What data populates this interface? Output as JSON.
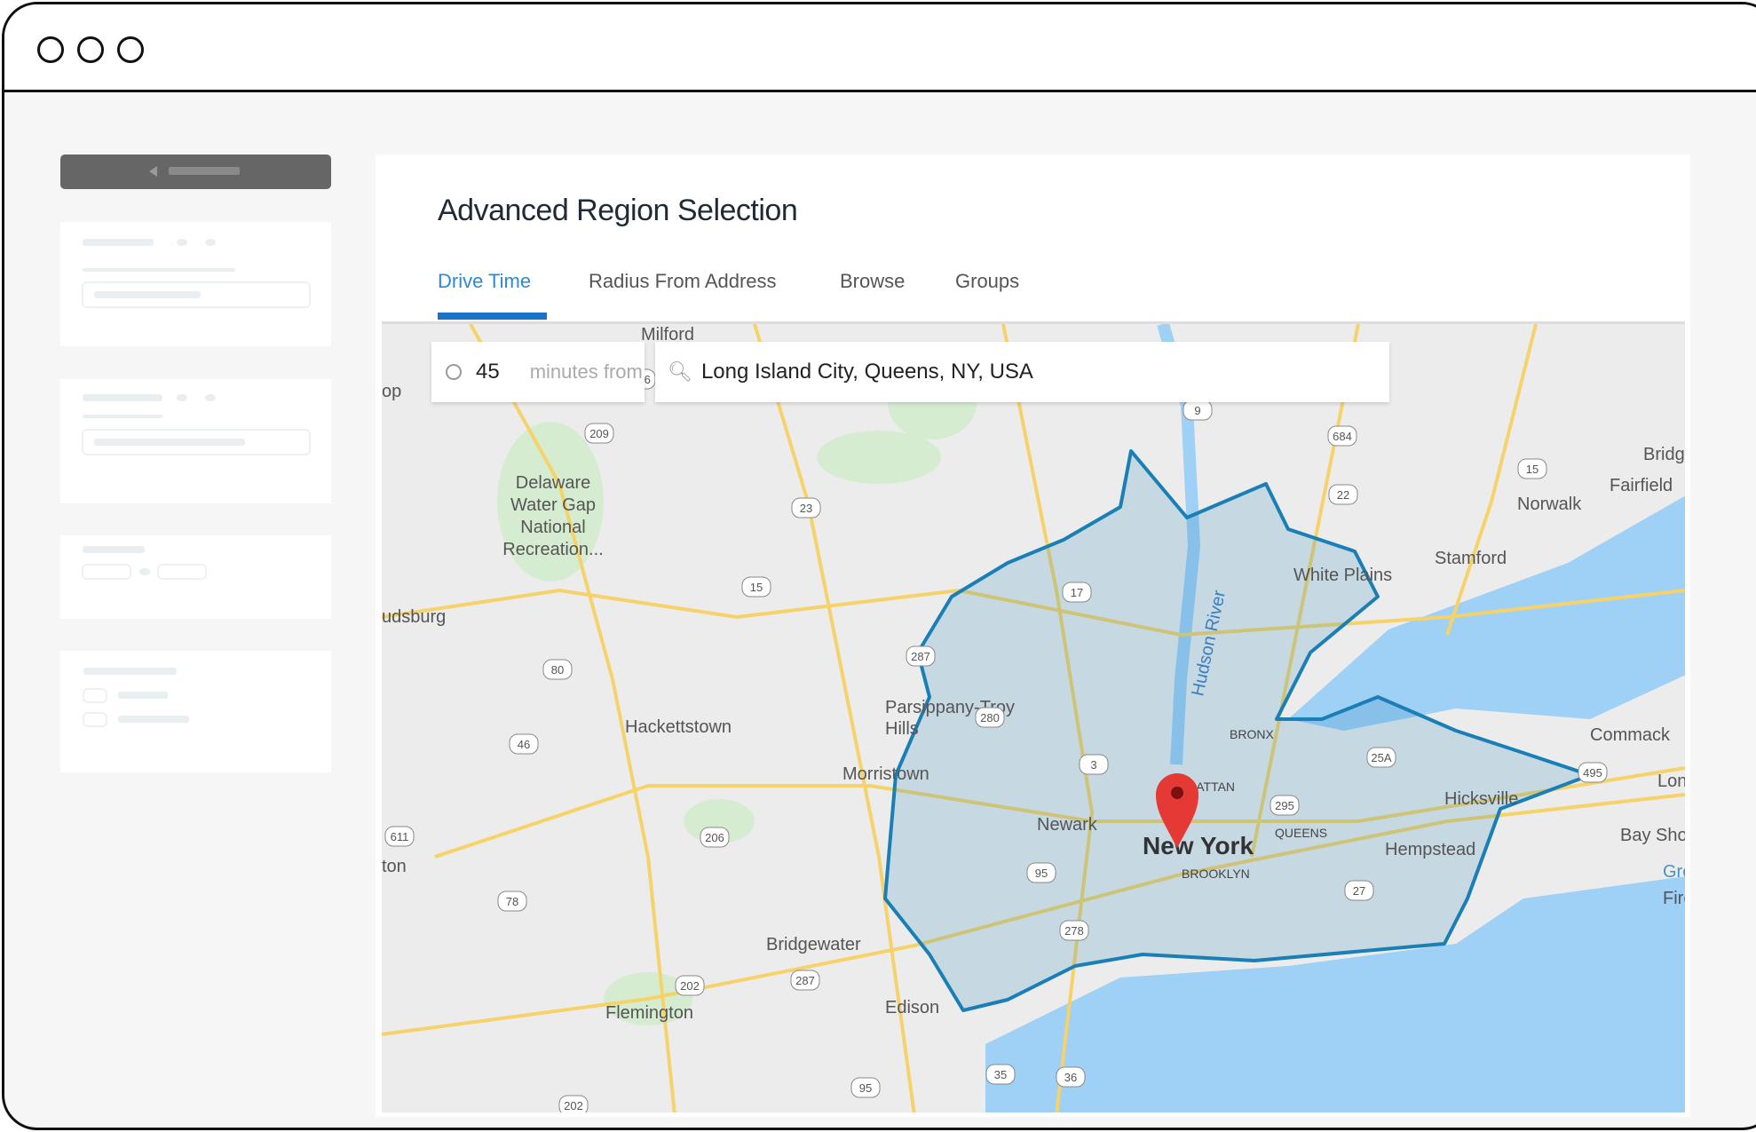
{
  "window": {
    "controls": [
      "close",
      "minimize",
      "maximize"
    ]
  },
  "panel": {
    "title": "Advanced Region Selection",
    "tabs": [
      {
        "label": "Drive Time",
        "active": true
      },
      {
        "label": "Radius From Address"
      },
      {
        "label": "Browse"
      },
      {
        "label": "Groups"
      }
    ]
  },
  "drive_time": {
    "minutes": "45",
    "minutes_suffix": "minutes from",
    "address": "Long Island City, Queens, NY, USA"
  },
  "map": {
    "labels": {
      "milford": "Milford",
      "delaware1": "Delaware",
      "delaware2": "Water Gap",
      "delaware3": "National",
      "delaware4": "Recreation...",
      "hackettstown": "Hackettstown",
      "parsippany1": "Parsippany-Troy",
      "parsippany2": "Hills",
      "morristown": "Morristown",
      "newark": "Newark",
      "new_york": "New York",
      "brooklyn": "BROOKLYN",
      "queens": "QUEENS",
      "bronx": "BRONX",
      "manhattan": "MANHATTAN",
      "hempstead": "Hempstead",
      "hicksville": "Hicksville",
      "commack": "Commack",
      "bay_shore": "Bay Shore",
      "long": "Long",
      "stamford": "Stamford",
      "norwalk": "Norwalk",
      "fairfield": "Fairfield",
      "bridgeport": "Bridgeport",
      "white_plains": "White Plains",
      "hudson": "Hudson River",
      "bridgewater": "Bridgewater",
      "flemington": "Flemington",
      "edison": "Edison",
      "udsburg": "udsburg",
      "ton": "ton",
      "op": "op",
      "great": "Great",
      "fire": "Fire Is"
    },
    "shields": [
      "209",
      "206",
      "23",
      "15",
      "17",
      "80",
      "287",
      "46",
      "280",
      "3",
      "95",
      "278",
      "295",
      "25A",
      "495",
      "684",
      "22",
      "9",
      "611",
      "206",
      "78",
      "202",
      "287",
      "95",
      "35",
      "36",
      "202",
      "27",
      "15"
    ],
    "colors": {
      "region": "#1a7fb5",
      "water": "#9fd0f5",
      "pin": "#e53935",
      "accent": "#2b8ad6"
    }
  }
}
